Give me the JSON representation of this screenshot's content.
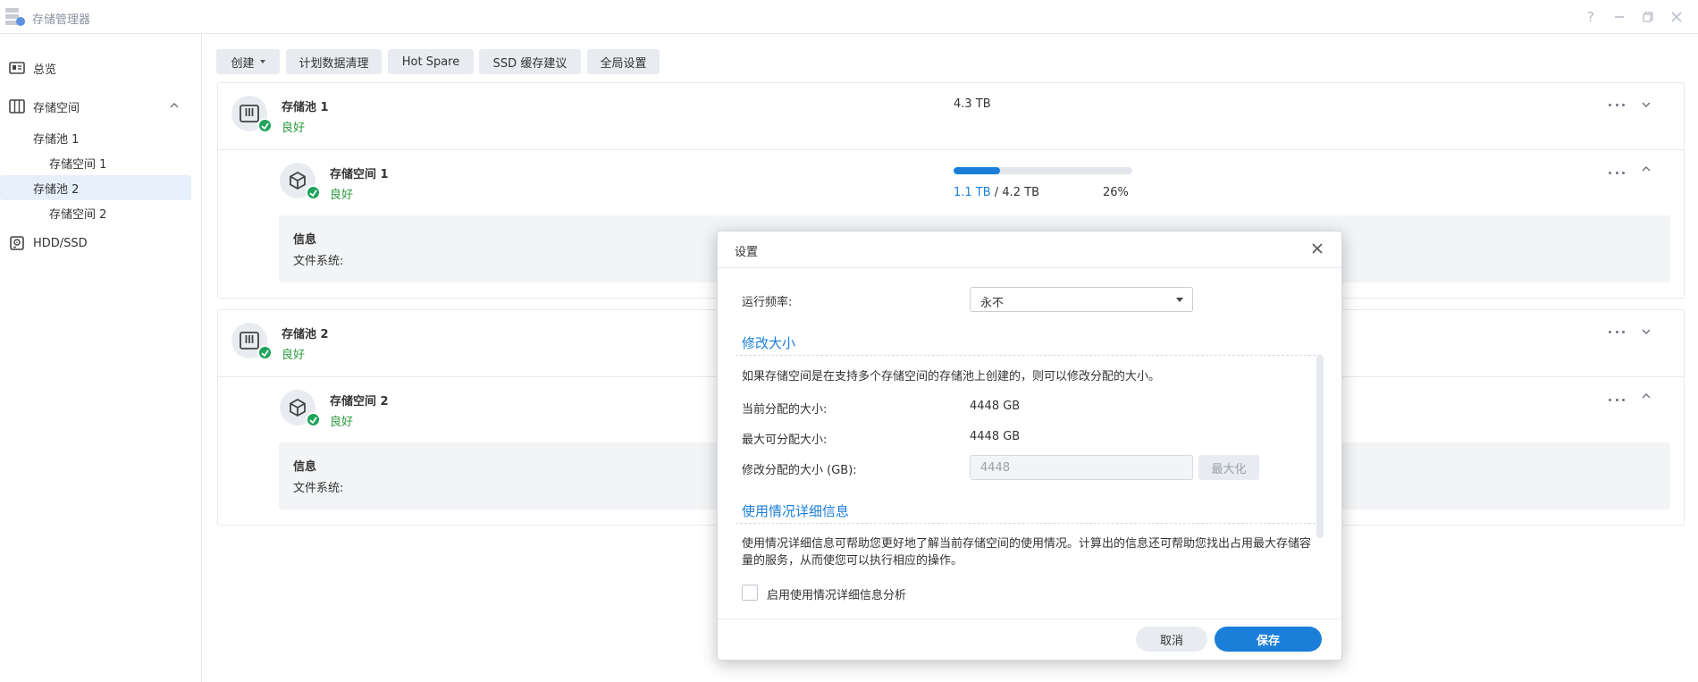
{
  "window": {
    "title": "存储管理器",
    "icon": "storage-manager-icon",
    "controls": [
      "help-icon",
      "minimize-icon",
      "restore-icon",
      "close-icon"
    ]
  },
  "sidebar": {
    "items": [
      {
        "label": "总览",
        "icon": "overview-icon"
      },
      {
        "label": "存储空间",
        "icon": "storage-icon",
        "expanded": true
      },
      {
        "label": "存储池 1"
      },
      {
        "label": "存储空间 1"
      },
      {
        "label": "存储池 2",
        "selected": true
      },
      {
        "label": "存储空间 2"
      },
      {
        "label": "HDD/SSD",
        "icon": "disk-icon"
      }
    ]
  },
  "toolbar": {
    "create": "创建",
    "scrub": "计划数据清理",
    "hot_spare": "Hot Spare",
    "ssd_cache": "SSD 缓存建议",
    "global_settings": "全局设置"
  },
  "pools": [
    {
      "name": "存储池 1",
      "status": "良好",
      "size": "4.3 TB",
      "volume": {
        "name": "存储空间 1",
        "status": "良好",
        "used": "1.1 TB",
        "separator": " / ",
        "total": "4.2 TB",
        "percent_label": "26%",
        "percent": 26,
        "info_title": "信息",
        "fs_label": "文件系统:"
      }
    },
    {
      "name": "存储池 2",
      "status": "良好",
      "volume": {
        "name": "存储空间 2",
        "status": "良好",
        "info_title": "信息",
        "fs_label": "文件系统:"
      }
    }
  ],
  "dialog": {
    "title": "设置",
    "frequency_label": "运行频率:",
    "frequency_value": "永不",
    "resize": {
      "title": "修改大小",
      "description": "如果存储空间是在支持多个存储空间的存储池上创建的，则可以修改分配的大小。",
      "current_label": "当前分配的大小:",
      "current_value": "4448 GB",
      "max_label": "最大可分配大小:",
      "max_value": "4448 GB",
      "modify_label": "修改分配的大小 (GB):",
      "modify_placeholder": "4448",
      "maximize_button": "最大化"
    },
    "usage": {
      "title": "使用情况详细信息",
      "description": "使用情况详细信息可帮助您更好地了解当前存储空间的使用情况。计算出的信息还可帮助您找出占用最大存储容量的服务，从而使您可以执行相应的操作。",
      "checkbox_label": "启用使用情况详细信息分析",
      "checked": false
    },
    "cancel": "取消",
    "save": "保存"
  },
  "colors": {
    "accent": "#1b7fd9",
    "status_ok": "#2b9a3c",
    "check_badge": "#1fa45a"
  }
}
